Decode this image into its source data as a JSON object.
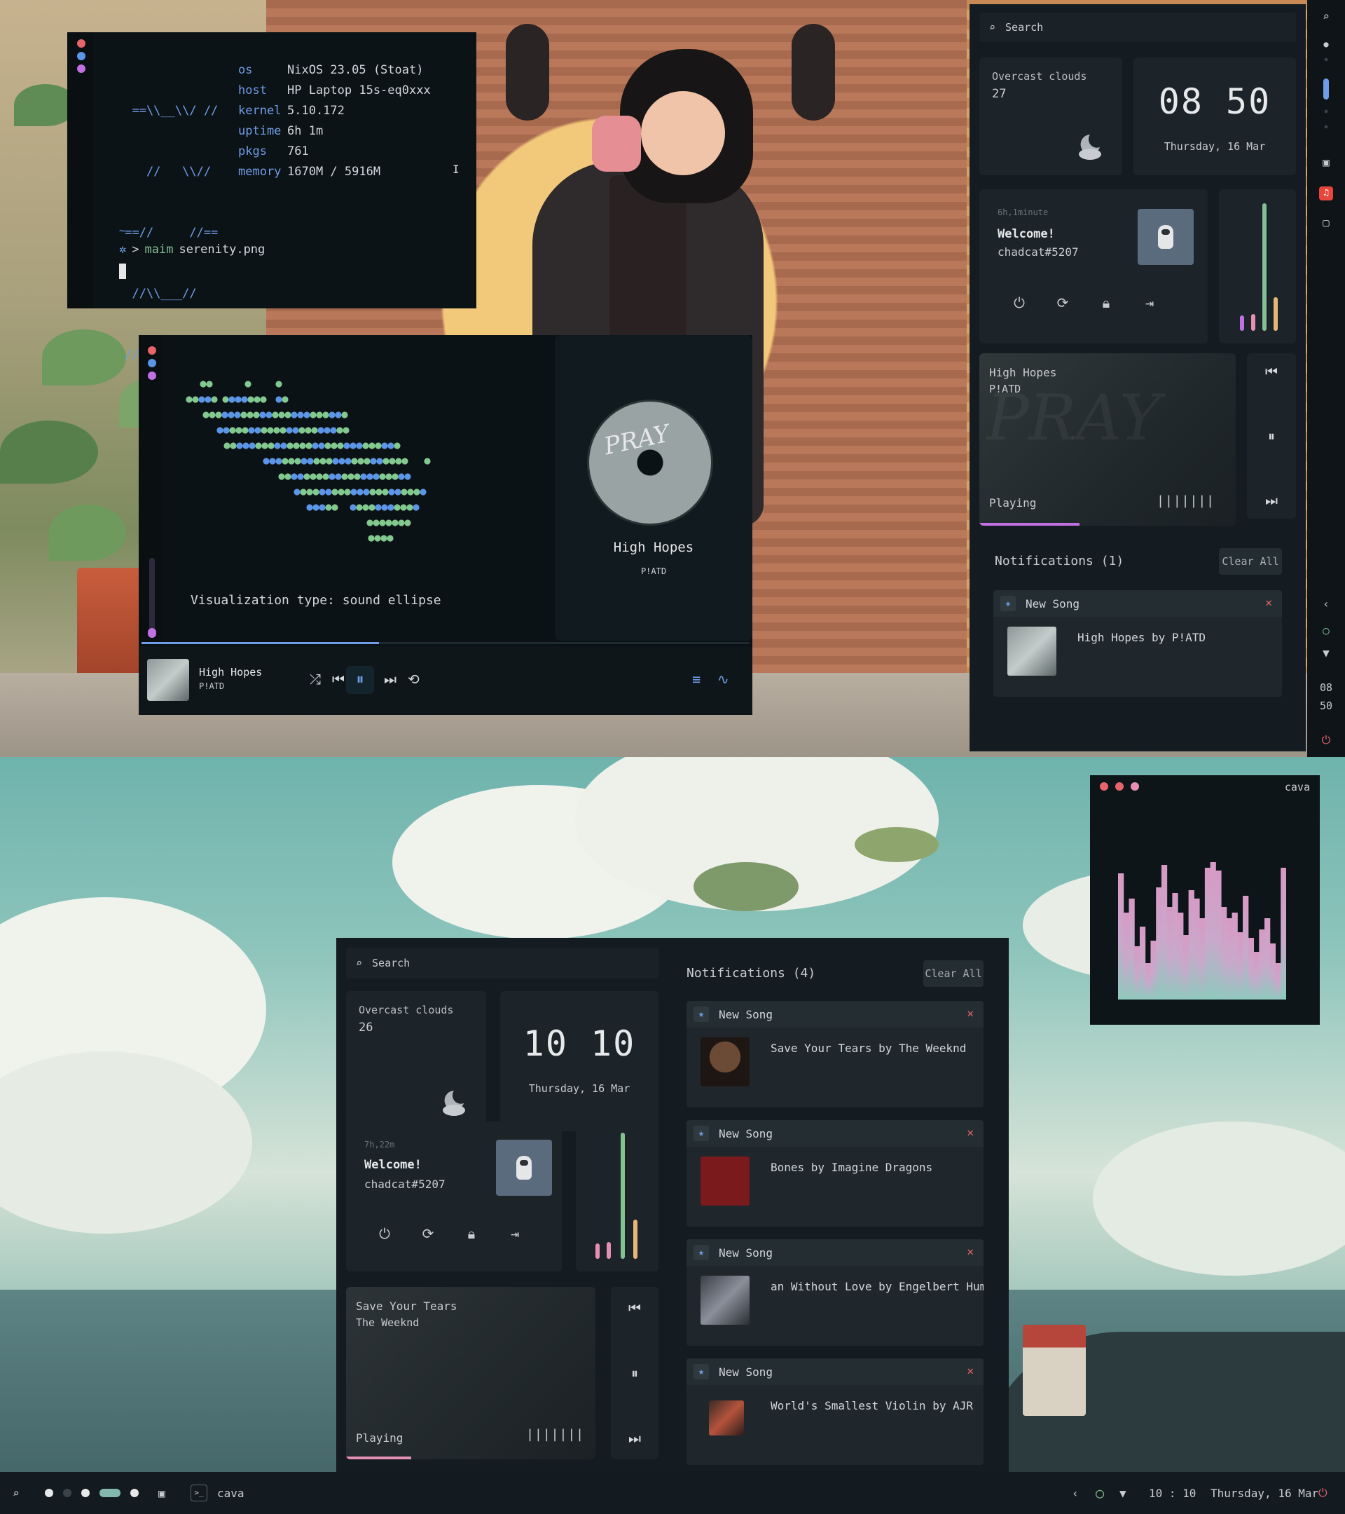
{
  "terminal": {
    "ascii": [
      "  ==\\\\__\\\\/ //",
      "    //   \\\\//",
      " ==//     //==",
      "  //\\\\___//",
      " // /\\\\  \\\\==",
      "   // \\\\  \\\\"
    ],
    "info": [
      {
        "key": "os",
        "value": "NixOS 23.05 (Stoat)"
      },
      {
        "key": "host",
        "value": "HP Laptop 15s-eq0xxx"
      },
      {
        "key": "kernel",
        "value": "5.10.172"
      },
      {
        "key": "uptime",
        "value": "6h 1m"
      },
      {
        "key": "pkgs",
        "value": "761"
      },
      {
        "key": "memory",
        "value": "1670M / 5916M"
      }
    ],
    "cwd": "~",
    "prompt_symbol": ">",
    "command": "maim",
    "argument": "serenity.png"
  },
  "player": {
    "visualization_label": "Visualization type: sound ellipse",
    "track_title": "High Hopes",
    "track_artist": "P!ATD",
    "disc_text": "PRAY",
    "progress": 0.39,
    "colors": {
      "accent": "#6f9ee6",
      "dot_green": "#83c98f",
      "dot_blue": "#5c95e8"
    }
  },
  "dash_top": {
    "search_placeholder": "Search",
    "weather": {
      "desc": "Overcast clouds",
      "temp": "27"
    },
    "clock": {
      "time": "08 50",
      "date": "Thursday, 16 Mar"
    },
    "user": {
      "uptime": "6h,1minute",
      "welcome": "Welcome!",
      "handle": "chadcat#5207"
    },
    "media": {
      "title": "High Hopes",
      "artist": "P!ATD",
      "status": "Playing",
      "progress": 0.39,
      "wave": "|||||||"
    },
    "notifications_title": "Notifications (1)",
    "clear_all": "Clear All",
    "notifications": [
      {
        "app": "New Song",
        "message": "High Hopes by P!ATD"
      }
    ]
  },
  "right_sidebar": {
    "clock_hour": "08",
    "clock_min": "50"
  },
  "cava": {
    "title": "cava",
    "levels": [
      0.9,
      0.62,
      0.72,
      0.38,
      0.52,
      0.26,
      0.42,
      0.8,
      0.96,
      0.66,
      0.76,
      0.62,
      0.46,
      0.78,
      0.72,
      0.58,
      0.94,
      0.98,
      0.92,
      0.66,
      0.58,
      0.62,
      0.48,
      0.74,
      0.44,
      0.34,
      0.5,
      0.58,
      0.4,
      0.26,
      0.94
    ],
    "colors": {
      "top": "#d79ac4",
      "bottom": "#8fc8bd"
    }
  },
  "dash_bot": {
    "search_placeholder": "Search",
    "weather": {
      "desc": "Overcast clouds",
      "temp": "26"
    },
    "clock": {
      "time": "10 10",
      "date": "Thursday, 16 Mar"
    },
    "user": {
      "uptime": "7h,22m",
      "welcome": "Welcome!",
      "handle": "chadcat#5207"
    },
    "media": {
      "title": "Save Your Tears",
      "artist": "The Weeknd",
      "status": "Playing",
      "progress": 0.26,
      "wave": "|||||||"
    },
    "notifications_title": "Notifications (4)",
    "clear_all": "Clear All",
    "notifications": [
      {
        "app": "New Song",
        "message": "Save Your Tears by The Weeknd"
      },
      {
        "app": "New Song",
        "message": "Bones by Imagine Dragons"
      },
      {
        "app": "New Song",
        "message": "an Without Love by Engelbert Humperd"
      },
      {
        "app": "New Song",
        "message": "World's Smallest Violin by AJR"
      }
    ]
  },
  "taskbar": {
    "app_label": "cava",
    "clock": "10 : 10",
    "date": "Thursday, 16 Mar"
  },
  "colors": {
    "green": "#83c092",
    "pink": "#e58fb3",
    "peach": "#e7b77a",
    "purple": "#c170e3",
    "red": "#e8646d"
  }
}
